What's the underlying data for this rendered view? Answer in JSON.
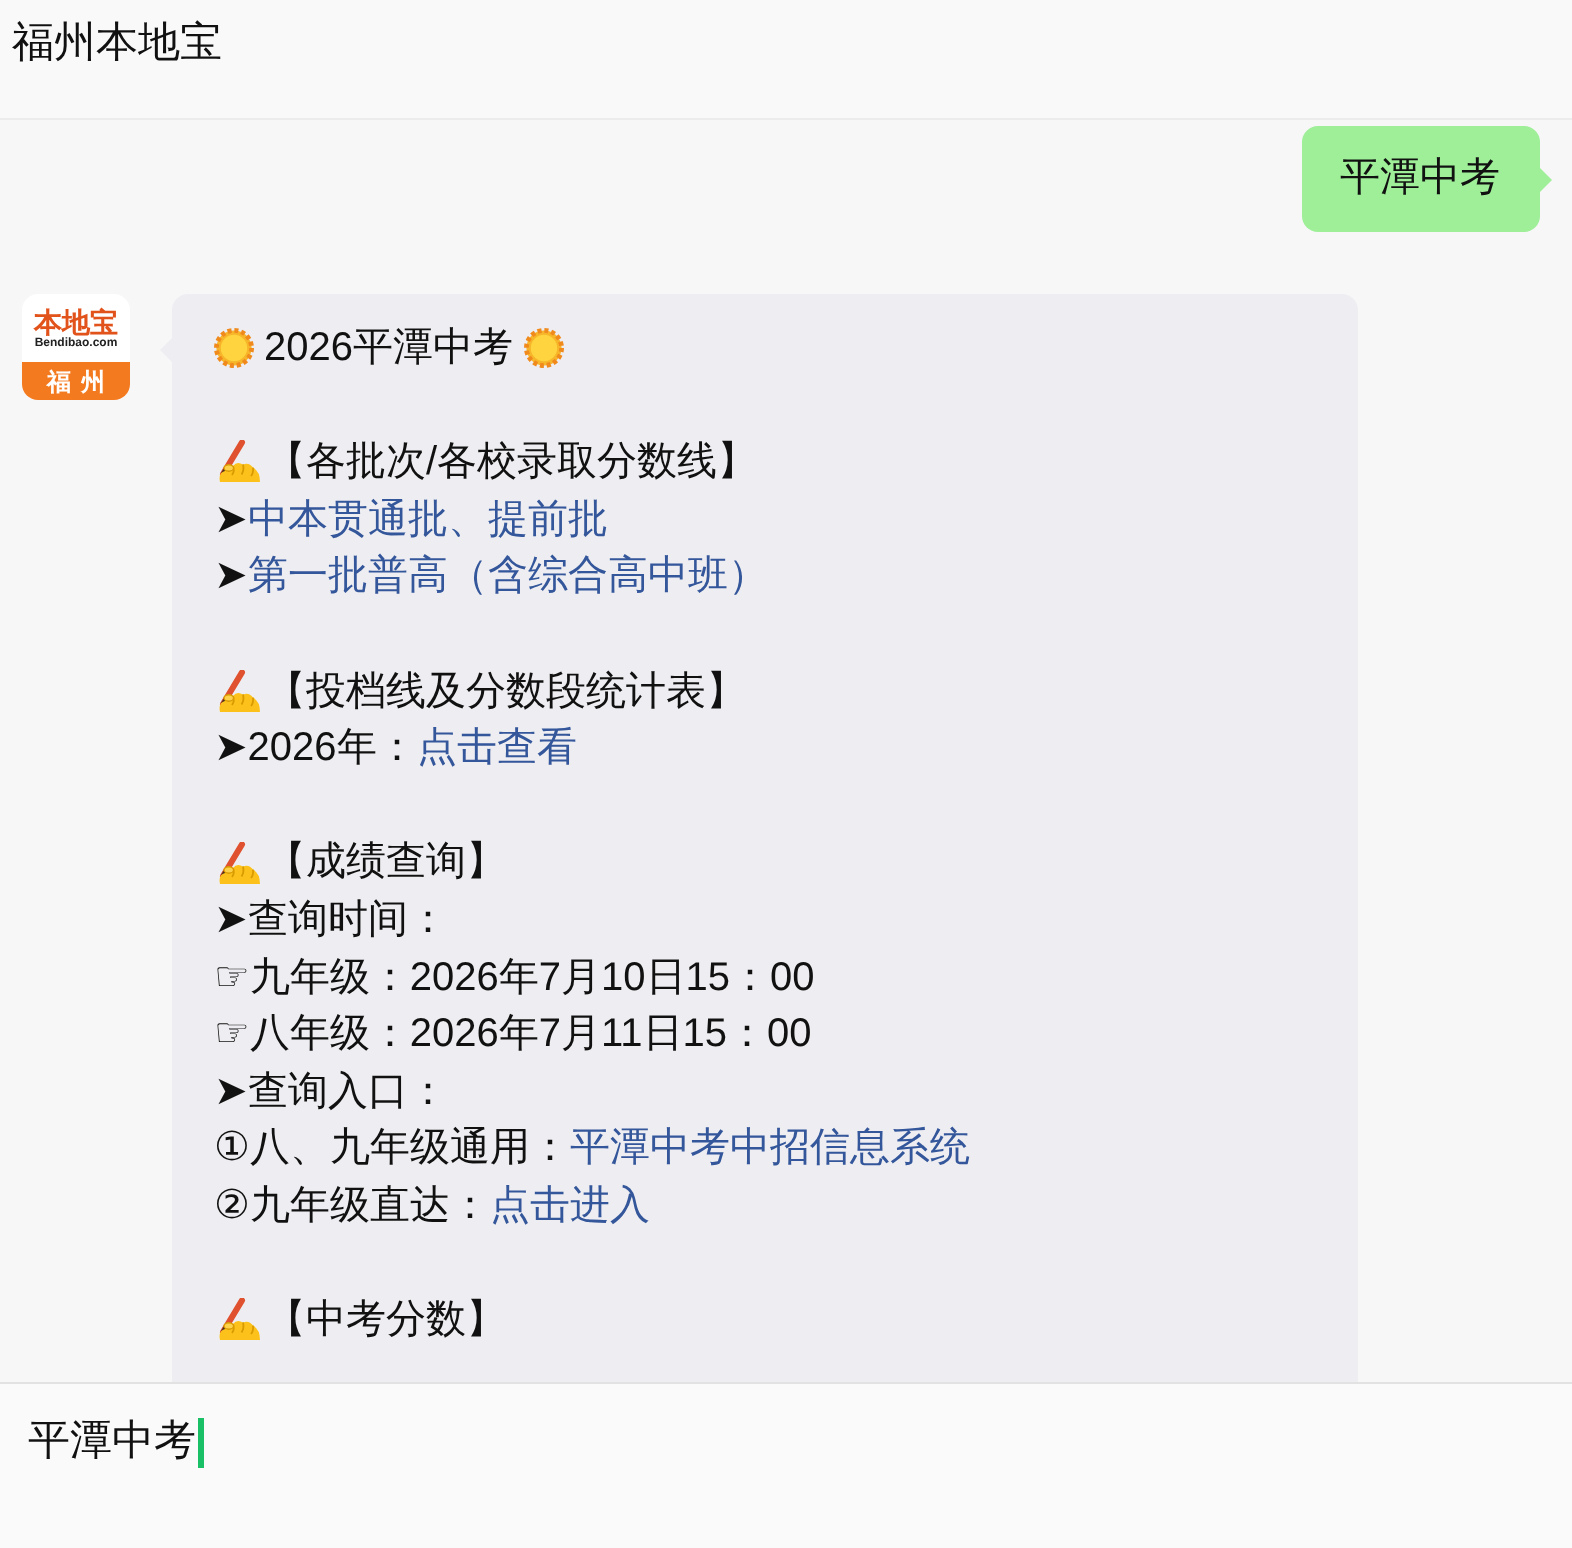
{
  "header": {
    "title": "福州本地宝"
  },
  "messages": [
    {
      "kind": "outgoing",
      "text": "平潭中考"
    },
    {
      "kind": "incoming",
      "avatar": {
        "brand": "本地宝",
        "domain": "Bendibao.com",
        "city": "福州"
      },
      "title": "2026平潭中考",
      "sections": [
        {
          "heading": "【各批次/各校录取分数线】",
          "lines": [
            {
              "text": "➤",
              "link": "中本贯通批、提前批"
            },
            {
              "text": "➤",
              "link": "第一批普高（含综合高中班）"
            }
          ]
        },
        {
          "heading": "【投档线及分数段统计表】",
          "lines": [
            {
              "text": "➤2026年：",
              "link": "点击查看"
            }
          ]
        },
        {
          "heading": "【成绩查询】",
          "lines": [
            {
              "text": "➤查询时间："
            },
            {
              "text": "☞九年级：2026年7月10日15：00"
            },
            {
              "text": "☞八年级：2026年7月11日15：00"
            },
            {
              "text": "➤查询入口："
            },
            {
              "text": "①八、九年级通用：",
              "link": "平潭中考中招信息系统"
            },
            {
              "text": "②九年级直达：",
              "link": "点击进入"
            }
          ]
        },
        {
          "heading": "【中考分数】"
        }
      ]
    }
  ],
  "composer": {
    "value": "平潭中考",
    "focused": true
  }
}
